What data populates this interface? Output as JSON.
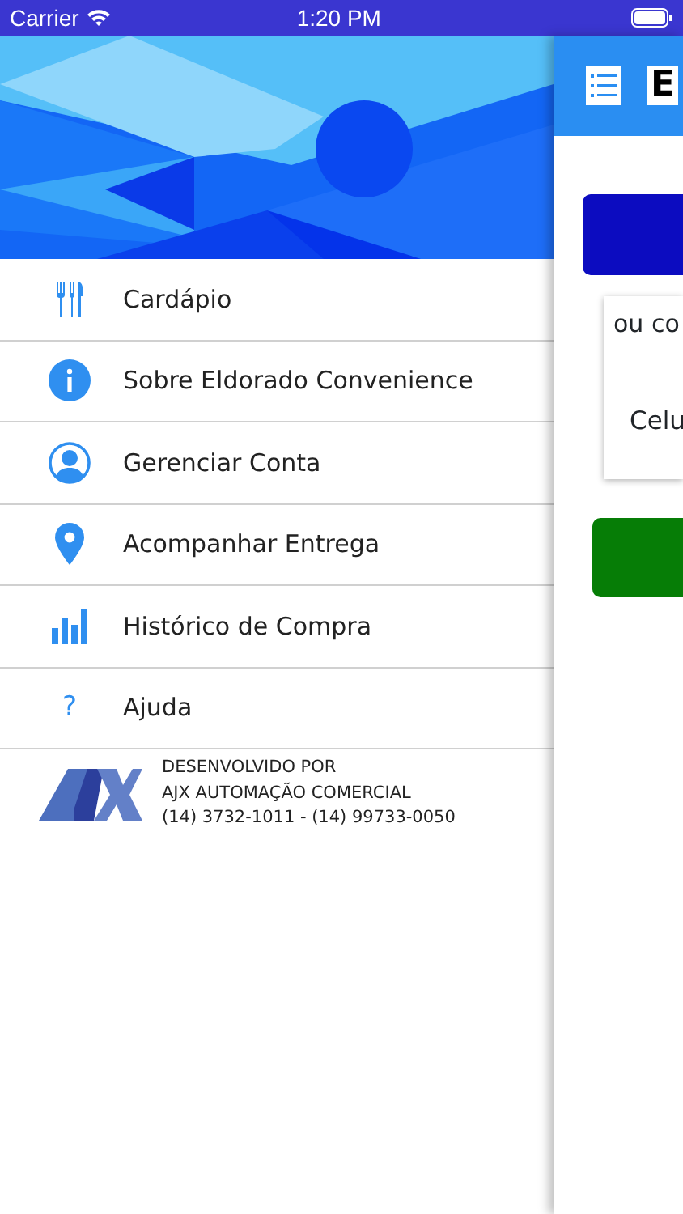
{
  "status_bar": {
    "carrier": "Carrier",
    "time": "1:20 PM"
  },
  "drawer": {
    "items": [
      {
        "kind": "cutlery",
        "label": "Cardápio"
      },
      {
        "kind": "info",
        "label": "Sobre Eldorado Convenience"
      },
      {
        "kind": "person",
        "label": "Gerenciar Conta"
      },
      {
        "kind": "pin",
        "label": "Acompanhar Entrega"
      },
      {
        "kind": "bars",
        "label": "Histórico de Compra"
      },
      {
        "kind": "glyph",
        "glyph": "?",
        "label": "Ajuda"
      }
    ],
    "footer": {
      "lines": [
        "DESENVOLVIDO POR",
        "AJX AUTOMAÇÃO COMERCIAL",
        "(14) 3732-1011 - (14) 99733-0050"
      ]
    }
  },
  "main": {
    "title": "E",
    "card_lines": [
      "ou co",
      "Celu"
    ]
  }
}
